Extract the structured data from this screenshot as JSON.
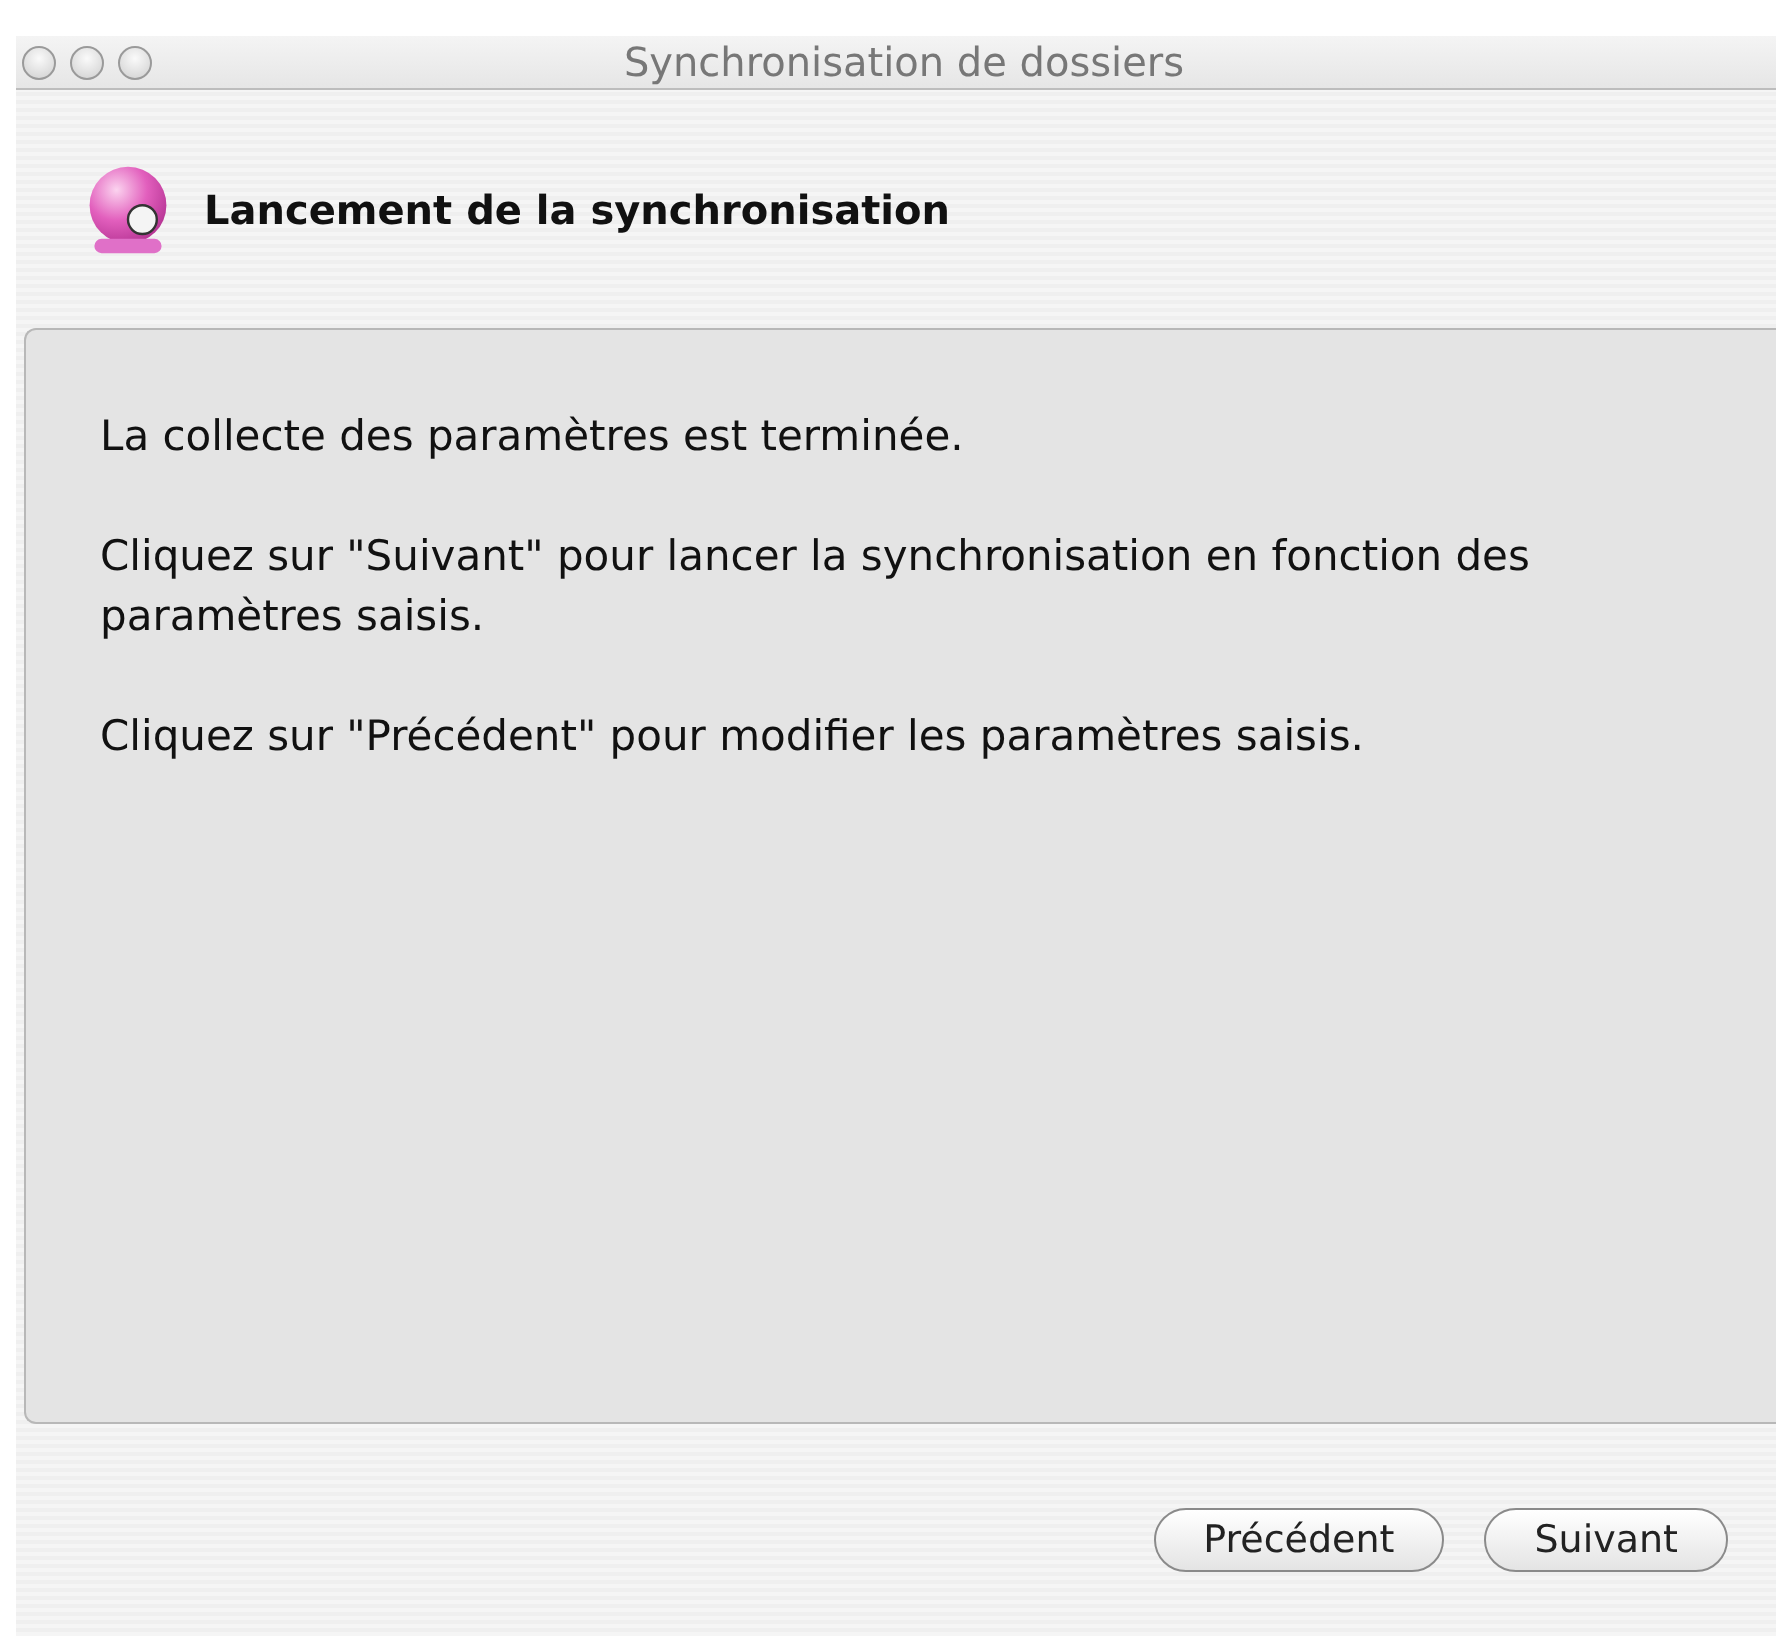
{
  "window": {
    "title": "Synchronisation de dossiers"
  },
  "header": {
    "title": "Lancement de la synchronisation"
  },
  "paragraphs": [
    "La collecte des paramètres est terminée.",
    "Cliquez sur \"Suivant\" pour lancer la synchronisation en fonction des paramètres saisis.",
    "Cliquez sur \"Précédent\" pour modifier les paramètres saisis."
  ],
  "buttons": [
    "Précédent",
    "Suivant"
  ]
}
